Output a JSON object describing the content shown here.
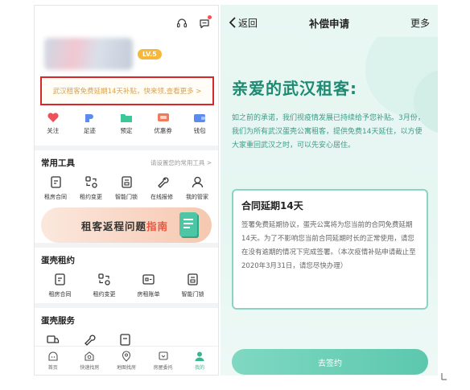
{
  "left": {
    "level_badge": "LV.5",
    "notice_text": "武汉租客免费延期14天补贴，快来领,查看更多 >",
    "quick_actions": [
      {
        "label": "关注",
        "icon": "heart-icon",
        "color": "#f0505a"
      },
      {
        "label": "足迹",
        "icon": "footprint-icon",
        "color": "#5a8cf0"
      },
      {
        "label": "预定",
        "icon": "folder-icon",
        "color": "#3cc79a"
      },
      {
        "label": "优惠券",
        "icon": "coupon-icon",
        "color": "#f07a5a"
      },
      {
        "label": "钱包",
        "icon": "wallet-icon",
        "color": "#5a8cf0"
      }
    ],
    "common_tools": {
      "title": "常用工具",
      "more": "请设置您的常用工具 >",
      "items": [
        {
          "label": "租房合同",
          "icon": "contract-icon"
        },
        {
          "label": "租约变更",
          "icon": "swap-icon"
        },
        {
          "label": "智能门锁",
          "icon": "lock-icon"
        },
        {
          "label": "在线报修",
          "icon": "wrench-icon"
        },
        {
          "label": "我的管家",
          "icon": "butler-icon"
        }
      ]
    },
    "banner": {
      "text_main": "租客返程问题",
      "text_highlight": "指南"
    },
    "lease": {
      "title": "蛋壳租约",
      "items": [
        {
          "label": "租房合同",
          "icon": "contract-icon"
        },
        {
          "label": "租约变更",
          "icon": "swap-icon"
        },
        {
          "label": "房租账单",
          "icon": "bill-icon"
        },
        {
          "label": "智能门锁",
          "icon": "lock-icon"
        }
      ]
    },
    "services": {
      "title": "蛋壳服务"
    },
    "tabbar": [
      {
        "label": "首页",
        "icon": "home-icon",
        "active": false
      },
      {
        "label": "快速找房",
        "icon": "search-house-icon",
        "active": false
      },
      {
        "label": "地图找房",
        "icon": "map-pin-icon",
        "active": false
      },
      {
        "label": "房屋委托",
        "icon": "entrust-icon",
        "active": false
      },
      {
        "label": "我的",
        "icon": "profile-icon",
        "active": true
      }
    ],
    "accent": "#3bb690"
  },
  "right": {
    "back_label": "返回",
    "title": "补偿申请",
    "more_label": "更多",
    "hero_title": "亲爱的武汉租客:",
    "hero_text": "如之前的承诺，我们视疫情发展已持续给予您补贴。3月份，我们为所有武汉蛋壳公寓租客，提供免费14天延住，以方便大家重回武汉之时，可以先安心居住。",
    "contract_title": "合同延期14天",
    "contract_body": "签署免费延期协议，蛋壳公寓将为您当前的合同免费延期14天。为了不影响您当前合同延期时长的正常使用，请您在没有逾期的情况下完成签署。（本次疫情补贴申请截止至2020年3月31日，请您尽快办理）",
    "sign_button": "去签约",
    "accent": "#1e8a72"
  }
}
